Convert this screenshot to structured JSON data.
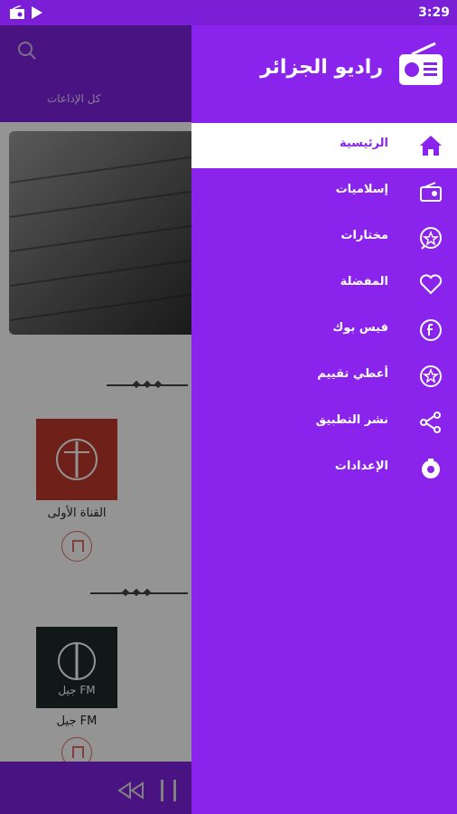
{
  "status_bar": {
    "time": "3:29"
  },
  "app": {
    "tab_label": "كل الإذاعات",
    "cards": [
      {
        "title": "القناة الأولى",
        "logo_color": "#c0392b"
      },
      {
        "title": "جيل FM",
        "logo_color": "#1f2a2a",
        "logo_text": "جيل FM"
      }
    ]
  },
  "drawer": {
    "title": "راديو الجزائر",
    "menu": [
      {
        "label": "الرئيسية",
        "icon": "home-icon",
        "active": true
      },
      {
        "label": "إسلاميات",
        "icon": "radio-icon"
      },
      {
        "label": "مختارات",
        "icon": "star-chat-icon"
      },
      {
        "label": "المفضلة",
        "icon": "heart-icon"
      },
      {
        "label": "فيس بوك",
        "icon": "facebook-icon"
      },
      {
        "label": "أعطي تقييم",
        "icon": "rate-icon"
      },
      {
        "label": "نشر التطبيق",
        "icon": "share-icon"
      },
      {
        "label": "الإعدادات",
        "icon": "settings-icon"
      }
    ]
  },
  "colors": {
    "accent": "#8a24ec",
    "active_bg": "#ffffff",
    "active_text": "#8a24ec",
    "bookmark": "#e26a6a"
  }
}
